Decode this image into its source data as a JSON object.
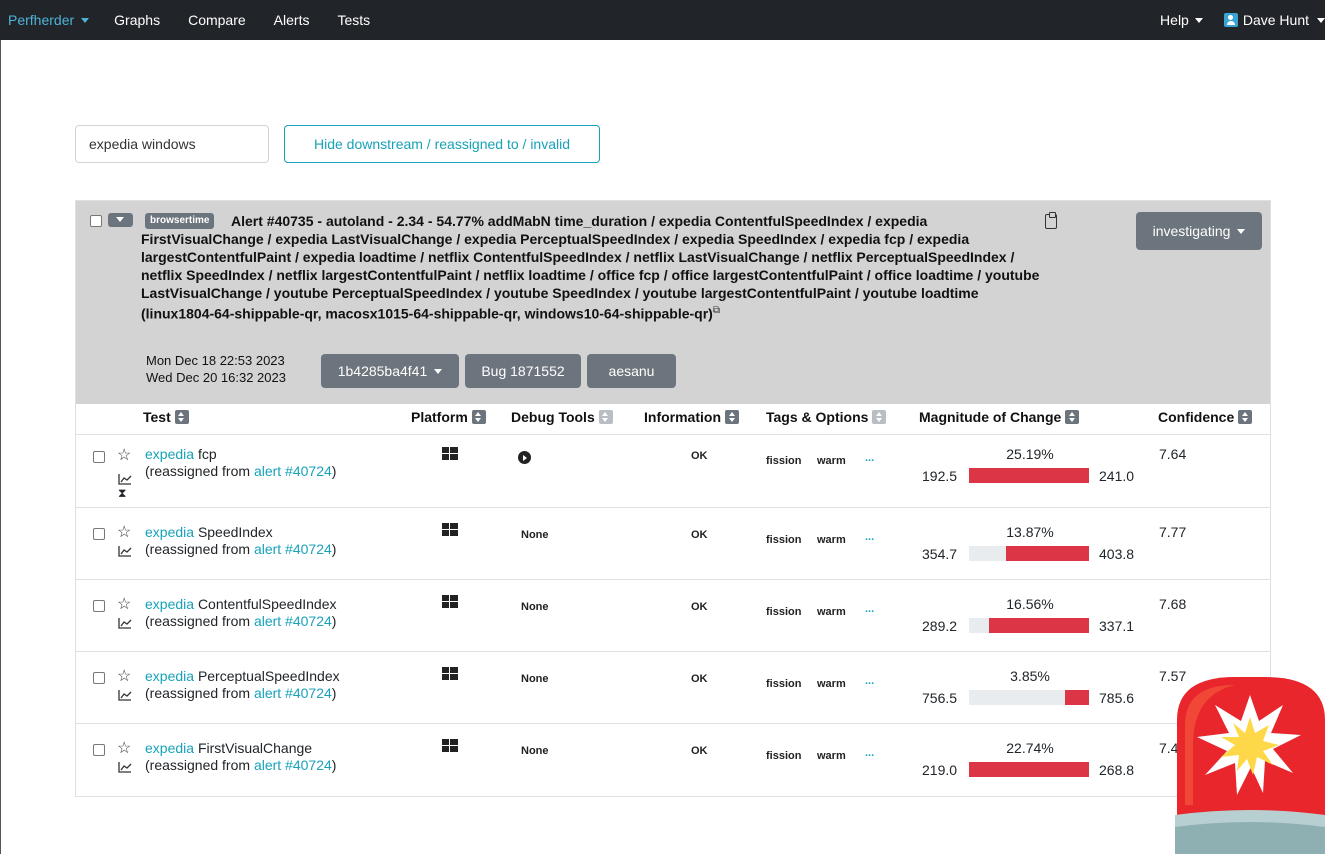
{
  "navbar": {
    "brand": "Perfherder",
    "links": [
      "Graphs",
      "Compare",
      "Alerts",
      "Tests"
    ],
    "help": "Help",
    "user": "Dave Hunt"
  },
  "filter": {
    "search_value": "expedia windows",
    "hide_button": "Hide downstream / reassigned to / invalid"
  },
  "alert": {
    "framework": "browsertime",
    "title": "Alert #40735 - autoland - 2.34 - 54.77% addMabN time_duration / expedia ContentfulSpeedIndex / expedia FirstVisualChange / expedia LastVisualChange / expedia PerceptualSpeedIndex / expedia SpeedIndex / expedia fcp / expedia largestContentfulPaint / expedia loadtime / netflix ContentfulSpeedIndex / netflix LastVisualChange / netflix PerceptualSpeedIndex / netflix SpeedIndex / netflix largestContentfulPaint / netflix loadtime / office fcp / office largestContentfulPaint / office loadtime / youtube LastVisualChange / youtube PerceptualSpeedIndex / youtube SpeedIndex / youtube largestContentfulPaint / youtube loadtime (linux1804-64-shippable-qr, macosx1015-64-shippable-qr, windows10-64-shippable-qr)",
    "status": "investigating",
    "created": "Mon Dec 18 22:53 2023",
    "modified": "Wed Dec 20 16:32 2023",
    "revision": "1b4285ba4f41",
    "bug": "Bug 1871552",
    "assignee": "aesanu"
  },
  "table": {
    "headers": {
      "test": "Test",
      "platform": "Platform",
      "debug_tools": "Debug Tools",
      "information": "Information",
      "tags": "Tags & Options",
      "magnitude": "Magnitude of Change",
      "confidence": "Confidence"
    },
    "rows": [
      {
        "suite": "expedia",
        "test": "fcp",
        "reassigned_prefix": "(reassigned from ",
        "reassigned_link": "alert #40724",
        "reassigned_suffix": ")",
        "debug": "",
        "info": "OK",
        "tag1": "fission",
        "tag2": "warm",
        "more": "...",
        "pct": "25.19%",
        "prev": "192.5",
        "new": "241.0",
        "confidence": "7.64",
        "magnitude_fraction": 1.0
      },
      {
        "suite": "expedia",
        "test": "SpeedIndex",
        "reassigned_prefix": "(reassigned from ",
        "reassigned_link": "alert #40724",
        "reassigned_suffix": ")",
        "debug": "None",
        "info": "OK",
        "tag1": "fission",
        "tag2": "warm",
        "more": "...",
        "pct": "13.87%",
        "prev": "354.7",
        "new": "403.8",
        "confidence": "7.77",
        "magnitude_fraction": 0.69
      },
      {
        "suite": "expedia",
        "test": "ContentfulSpeedIndex",
        "reassigned_prefix": "(reassigned from ",
        "reassigned_link": "alert #40724",
        "reassigned_suffix": ")",
        "debug": "None",
        "info": "OK",
        "tag1": "fission",
        "tag2": "warm",
        "more": "...",
        "pct": "16.56%",
        "prev": "289.2",
        "new": "337.1",
        "confidence": "7.68",
        "magnitude_fraction": 0.83
      },
      {
        "suite": "expedia",
        "test": "PerceptualSpeedIndex",
        "reassigned_prefix": "(reassigned from ",
        "reassigned_link": "alert #40724",
        "reassigned_suffix": ")",
        "debug": "None",
        "info": "OK",
        "tag1": "fission",
        "tag2": "warm",
        "more": "...",
        "pct": "3.85%",
        "prev": "756.5",
        "new": "785.6",
        "confidence": "7.57",
        "magnitude_fraction": 0.2
      },
      {
        "suite": "expedia",
        "test": "FirstVisualChange",
        "reassigned_prefix": "(reassigned from ",
        "reassigned_link": "alert #40724",
        "reassigned_suffix": ")",
        "debug": "None",
        "info": "OK",
        "tag1": "fission",
        "tag2": "warm",
        "more": "...",
        "pct": "22.74%",
        "prev": "219.0",
        "new": "268.8",
        "confidence": "7.4",
        "magnitude_fraction": 1.0
      }
    ]
  },
  "colors": {
    "navbar_bg": "#212529",
    "brand": "#4db3d9",
    "link": "#17a2b8",
    "regression_bar": "#dc3545",
    "header_bg": "#d3d3d3",
    "button_grey": "#6c757d"
  },
  "icons": {
    "platform": "windows-icon",
    "debug": "play-icon",
    "row_extra": "hourglass-icon",
    "siren": "siren-icon"
  }
}
